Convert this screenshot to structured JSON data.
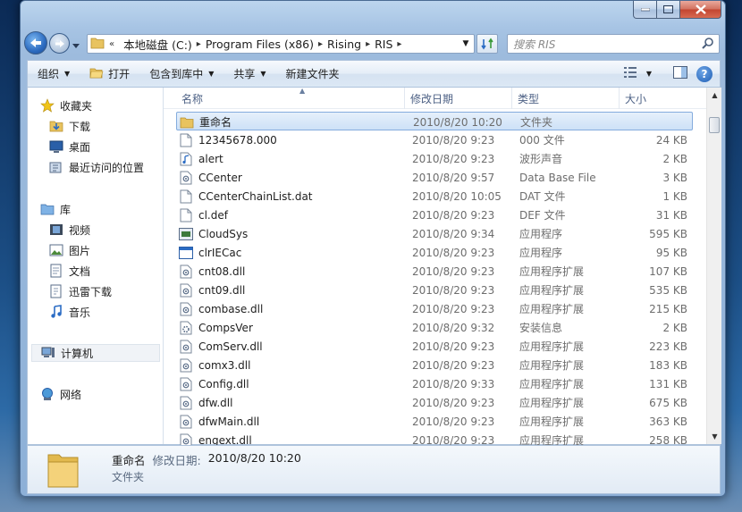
{
  "window": {
    "caption_buttons": [
      "minimize",
      "maximize",
      "close"
    ]
  },
  "address": {
    "breadcrumbs": [
      "本地磁盘 (C:)",
      "Program Files (x86)",
      "Rising",
      "RIS"
    ],
    "search_placeholder": "搜索 RIS"
  },
  "toolbar": {
    "organize": "组织",
    "open": "打开",
    "include_library": "包含到库中",
    "share": "共享",
    "new_folder": "新建文件夹"
  },
  "sidebar": {
    "favorites": "收藏夹",
    "downloads": "下载",
    "desktop": "桌面",
    "recent": "最近访问的位置",
    "libraries": "库",
    "videos": "视频",
    "pictures": "图片",
    "documents": "文档",
    "thunder": "迅雷下载",
    "music": "音乐",
    "computer": "计算机",
    "network": "网络"
  },
  "columns": {
    "name": "名称",
    "date": "修改日期",
    "type": "类型",
    "size": "大小"
  },
  "files": [
    {
      "name": "重命名",
      "date": "2010/8/20 10:20",
      "type": "文件夹",
      "size": "",
      "icon": "folder-icon"
    },
    {
      "name": "12345678.000",
      "date": "2010/8/20 9:23",
      "type": "000 文件",
      "size": "24 KB",
      "icon": "file-icon"
    },
    {
      "name": "alert",
      "date": "2010/8/20 9:23",
      "type": "波形声音",
      "size": "2 KB",
      "icon": "audio-file-icon"
    },
    {
      "name": "CCenter",
      "date": "2010/8/20 9:57",
      "type": "Data Base File",
      "size": "3 KB",
      "icon": "dll-icon"
    },
    {
      "name": "CCenterChainList.dat",
      "date": "2010/8/20 10:05",
      "type": "DAT 文件",
      "size": "1 KB",
      "icon": "file-icon"
    },
    {
      "name": "cl.def",
      "date": "2010/8/20 9:23",
      "type": "DEF 文件",
      "size": "31 KB",
      "icon": "file-icon"
    },
    {
      "name": "CloudSys",
      "date": "2010/8/20 9:34",
      "type": "应用程序",
      "size": "595 KB",
      "icon": "app-icon"
    },
    {
      "name": "clrIECac",
      "date": "2010/8/20 9:23",
      "type": "应用程序",
      "size": "95 KB",
      "icon": "window-app-icon"
    },
    {
      "name": "cnt08.dll",
      "date": "2010/8/20 9:23",
      "type": "应用程序扩展",
      "size": "107 KB",
      "icon": "dll-icon"
    },
    {
      "name": "cnt09.dll",
      "date": "2010/8/20 9:23",
      "type": "应用程序扩展",
      "size": "535 KB",
      "icon": "dll-icon"
    },
    {
      "name": "combase.dll",
      "date": "2010/8/20 9:23",
      "type": "应用程序扩展",
      "size": "215 KB",
      "icon": "dll-icon"
    },
    {
      "name": "CompsVer",
      "date": "2010/8/20 9:32",
      "type": "安装信息",
      "size": "2 KB",
      "icon": "gear-file-icon"
    },
    {
      "name": "ComServ.dll",
      "date": "2010/8/20 9:23",
      "type": "应用程序扩展",
      "size": "223 KB",
      "icon": "dll-icon"
    },
    {
      "name": "comx3.dll",
      "date": "2010/8/20 9:23",
      "type": "应用程序扩展",
      "size": "183 KB",
      "icon": "dll-icon"
    },
    {
      "name": "Config.dll",
      "date": "2010/8/20 9:33",
      "type": "应用程序扩展",
      "size": "131 KB",
      "icon": "dll-icon"
    },
    {
      "name": "dfw.dll",
      "date": "2010/8/20 9:23",
      "type": "应用程序扩展",
      "size": "675 KB",
      "icon": "dll-icon"
    },
    {
      "name": "dfwMain.dll",
      "date": "2010/8/20 9:23",
      "type": "应用程序扩展",
      "size": "363 KB",
      "icon": "dll-icon"
    },
    {
      "name": "engext.dll",
      "date": "2010/8/20 9:23",
      "type": "应用程序扩展",
      "size": "258 KB",
      "icon": "dll-icon"
    }
  ],
  "details": {
    "name": "重命名",
    "date_label": "修改日期:",
    "date": "2010/8/20 10:20",
    "type": "文件夹"
  }
}
